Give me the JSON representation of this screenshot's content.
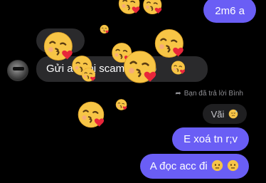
{
  "messages": {
    "top_sent": "2m6 a",
    "received": "Gửi a ... bị scam ... cho",
    "reply_note": "Bạn đã trả lời Bình",
    "quoted": "Vãi",
    "sent_1": "E xoá tn r;v",
    "sent_2": "A đọc acc đi"
  },
  "colors": {
    "sent_bubble": "#6a5ef5",
    "received_bubble": "#2a2a2c",
    "background": "#000000"
  },
  "icons": {
    "reply": "reply-arrow-icon",
    "reaction": "face-blowing-kiss-emoji",
    "quoted_reaction": "downcast-sweat-emoji",
    "trailing": "neutral-face-emoji"
  }
}
